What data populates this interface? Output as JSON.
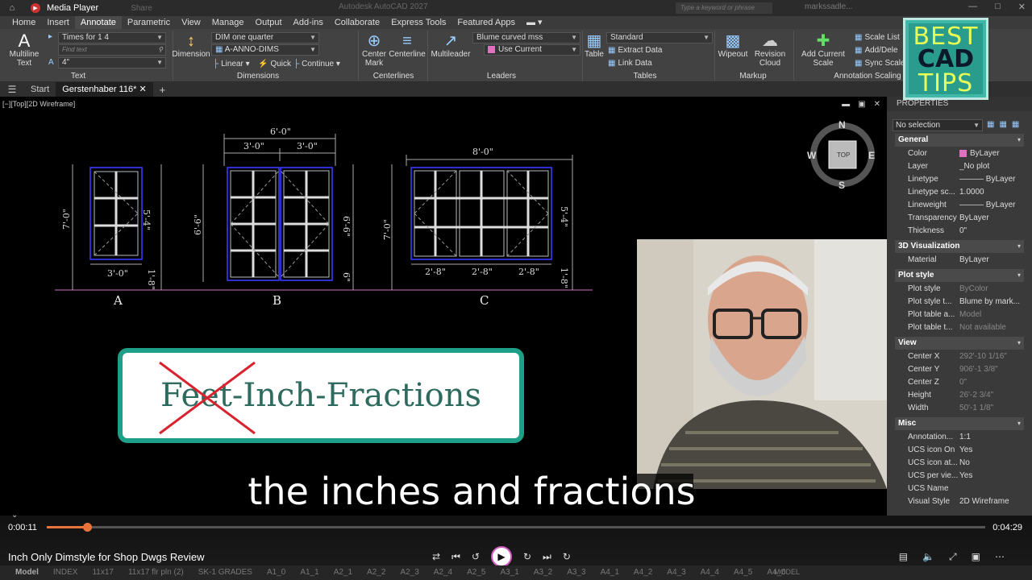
{
  "titlebar": {
    "media_player_title": "Media Player",
    "share_label": "Share",
    "app_title": "Autodesk AutoCAD 2027",
    "search_placeholder": "Type a keyword or phrase",
    "user": "markssadle..."
  },
  "ribbon_tabs": [
    "Home",
    "Insert",
    "Annotate",
    "Parametric",
    "View",
    "Manage",
    "Output",
    "Add-ins",
    "Collaborate",
    "Express Tools",
    "Featured Apps"
  ],
  "ribbon": {
    "text_panel": {
      "multiline_text": "Multiline Text",
      "font": "Times for 1 4",
      "find_placeholder": "Find text",
      "height": "4\"",
      "label": "Text"
    },
    "dimensions_panel": {
      "dimension": "Dimension",
      "dim_style": "DIM one quarter",
      "layer": "A-ANNO-DIMS",
      "linear": "Linear",
      "quick": "Quick",
      "continue": "Continue",
      "label": "Dimensions"
    },
    "centerlines_panel": {
      "center_mark": "Center Mark",
      "centerline": "Centerline",
      "label": "Centerlines"
    },
    "leaders_panel": {
      "multileader": "Multileader",
      "style": "Blume curved mss",
      "use_current": "Use Current",
      "label": "Leaders"
    },
    "tables_panel": {
      "table": "Table",
      "style": "Standard",
      "extract": "Extract Data",
      "link": "Link Data",
      "label": "Tables"
    },
    "markup_panel": {
      "wipeout": "Wipeout",
      "revision_cloud": "Revision Cloud",
      "label": "Markup"
    },
    "scaling_panel": {
      "add_current_scale": "Add Current Scale",
      "scale_list": "Scale List",
      "add_delete": "Add/Dele",
      "sync": "Sync Scale",
      "label": "Annotation Scaling"
    }
  },
  "doc_tabs": {
    "start": "Start",
    "active": "Gerstenhaber 116*"
  },
  "viewport_label": "[−][Top][2D Wireframe]",
  "viewcube": {
    "n": "N",
    "s": "S",
    "e": "E",
    "w": "W",
    "top": "TOP"
  },
  "drawing": {
    "window_a": {
      "label": "A",
      "height": "7'-0\"",
      "width": "3'-0\"",
      "right_upper": "5'-4\"",
      "right_lower": "1'-8\""
    },
    "window_b": {
      "label": "B",
      "overall": "6'-0\"",
      "left_width": "3'-0\"",
      "right_width": "3'-0\"",
      "left_height": "6'-6\"",
      "right_height": "6'-6\"",
      "sill": "6\""
    },
    "window_c": {
      "label": "C",
      "overall": "8'-0\"",
      "height": "7'-0\"",
      "pane1": "2'-8\"",
      "pane2": "2'-8\"",
      "pane3": "2'-8\"",
      "right_upper": "5'-4\"",
      "right_lower": "1'-8\""
    }
  },
  "callout": {
    "text": "Feet-Inch-Fractions",
    "accent_color": "#1f9f87",
    "strike_color": "#d9232e"
  },
  "caption": "the inches and fractions",
  "properties": {
    "title": "PROPERTIES",
    "selection": "No selection",
    "sections": [
      {
        "name": "General",
        "rows": [
          {
            "key": "Color",
            "value": "ByLayer",
            "swatch": true
          },
          {
            "key": "Layer",
            "value": "_No plot"
          },
          {
            "key": "Linetype",
            "value": "——— ByLayer"
          },
          {
            "key": "Linetype sc...",
            "value": "1.0000"
          },
          {
            "key": "Lineweight",
            "value": "——— ByLayer"
          },
          {
            "key": "Transparency",
            "value": "ByLayer"
          },
          {
            "key": "Thickness",
            "value": "0\""
          }
        ]
      },
      {
        "name": "3D Visualization",
        "rows": [
          {
            "key": "Material",
            "value": "ByLayer"
          }
        ]
      },
      {
        "name": "Plot style",
        "rows": [
          {
            "key": "Plot style",
            "value": "ByColor",
            "dim": true
          },
          {
            "key": "Plot style t...",
            "value": "Blume by mark..."
          },
          {
            "key": "Plot table a...",
            "value": "Model",
            "dim": true
          },
          {
            "key": "Plot table t...",
            "value": "Not available",
            "dim": true
          }
        ]
      },
      {
        "name": "View",
        "rows": [
          {
            "key": "Center X",
            "value": "292'-10 1/16\"",
            "dim": true
          },
          {
            "key": "Center Y",
            "value": "906'-1 3/8\"",
            "dim": true
          },
          {
            "key": "Center Z",
            "value": "0\"",
            "dim": true
          },
          {
            "key": "Height",
            "value": "26'-2 3/4\"",
            "dim": true
          },
          {
            "key": "Width",
            "value": "50'-1 1/8\"",
            "dim": true
          }
        ]
      },
      {
        "name": "Misc",
        "rows": [
          {
            "key": "Annotation...",
            "value": "1:1"
          },
          {
            "key": "UCS icon On",
            "value": "Yes"
          },
          {
            "key": "UCS icon at...",
            "value": "No"
          },
          {
            "key": "UCS per vie...",
            "value": "Yes"
          },
          {
            "key": "UCS Name",
            "value": ""
          },
          {
            "key": "Visual Style",
            "value": "2D Wireframe"
          }
        ]
      }
    ]
  },
  "player": {
    "current_time": "0:00:11",
    "total_time": "0:04:29",
    "progress": 0.043,
    "title": "Inch Only Dimstyle for Shop Dwgs Review",
    "accent_color": "#e8743b"
  },
  "layout_tabs": [
    "Model",
    "INDEX",
    "11x17",
    "11x17 flr pln (2)",
    "SK-1 GRADES",
    "A1_0",
    "A1_1",
    "A2_1",
    "A2_2",
    "A2_3",
    "A2_4",
    "A2_5",
    "A3_1",
    "A3_2",
    "A3_3",
    "A4_1",
    "A4_2",
    "A4_3",
    "A4_4",
    "A4_5",
    "A4_6"
  ],
  "status_model": "MODEL",
  "logo": {
    "line1": "BEST",
    "line2": "CAD",
    "line3": "TIPS"
  }
}
